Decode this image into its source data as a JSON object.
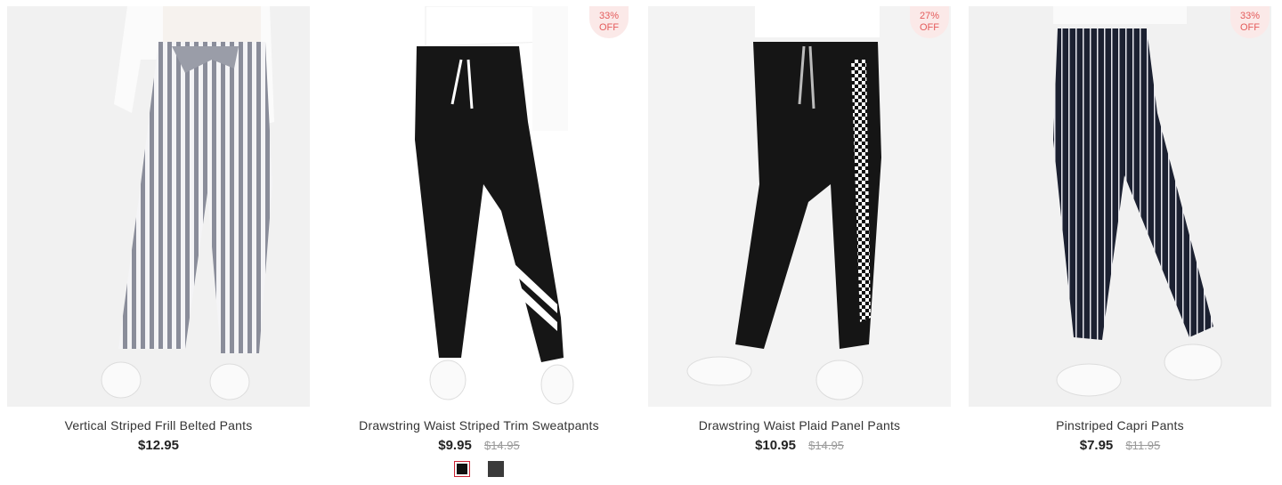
{
  "products": [
    {
      "title": "Vertical Striped Frill Belted Pants",
      "price": "$12.95",
      "old_price": "",
      "badge": null,
      "image": "striped-belted-pants"
    },
    {
      "title": "Drawstring Waist Striped Trim Sweatpants",
      "price": "$9.95",
      "old_price": "$14.95",
      "badge": {
        "percent": "33%",
        "label": "OFF"
      },
      "image": "black-sweatpants",
      "swatches": [
        {
          "color": "#111111",
          "selected": true
        },
        {
          "color": "#3a3a3a",
          "selected": false
        }
      ]
    },
    {
      "title": "Drawstring Waist Plaid Panel Pants",
      "price": "$10.95",
      "old_price": "$14.95",
      "badge": {
        "percent": "27%",
        "label": "OFF"
      },
      "image": "checker-panel-pants"
    },
    {
      "title": "Pinstriped Capri Pants",
      "price": "$7.95",
      "old_price": "$11.95",
      "badge": {
        "percent": "33%",
        "label": "OFF"
      },
      "image": "navy-pinstripe-pants"
    }
  ],
  "colors": {
    "badge_text": "#e45b5b",
    "badge_bg": "#fbe9e8",
    "old_price": "#999999"
  }
}
